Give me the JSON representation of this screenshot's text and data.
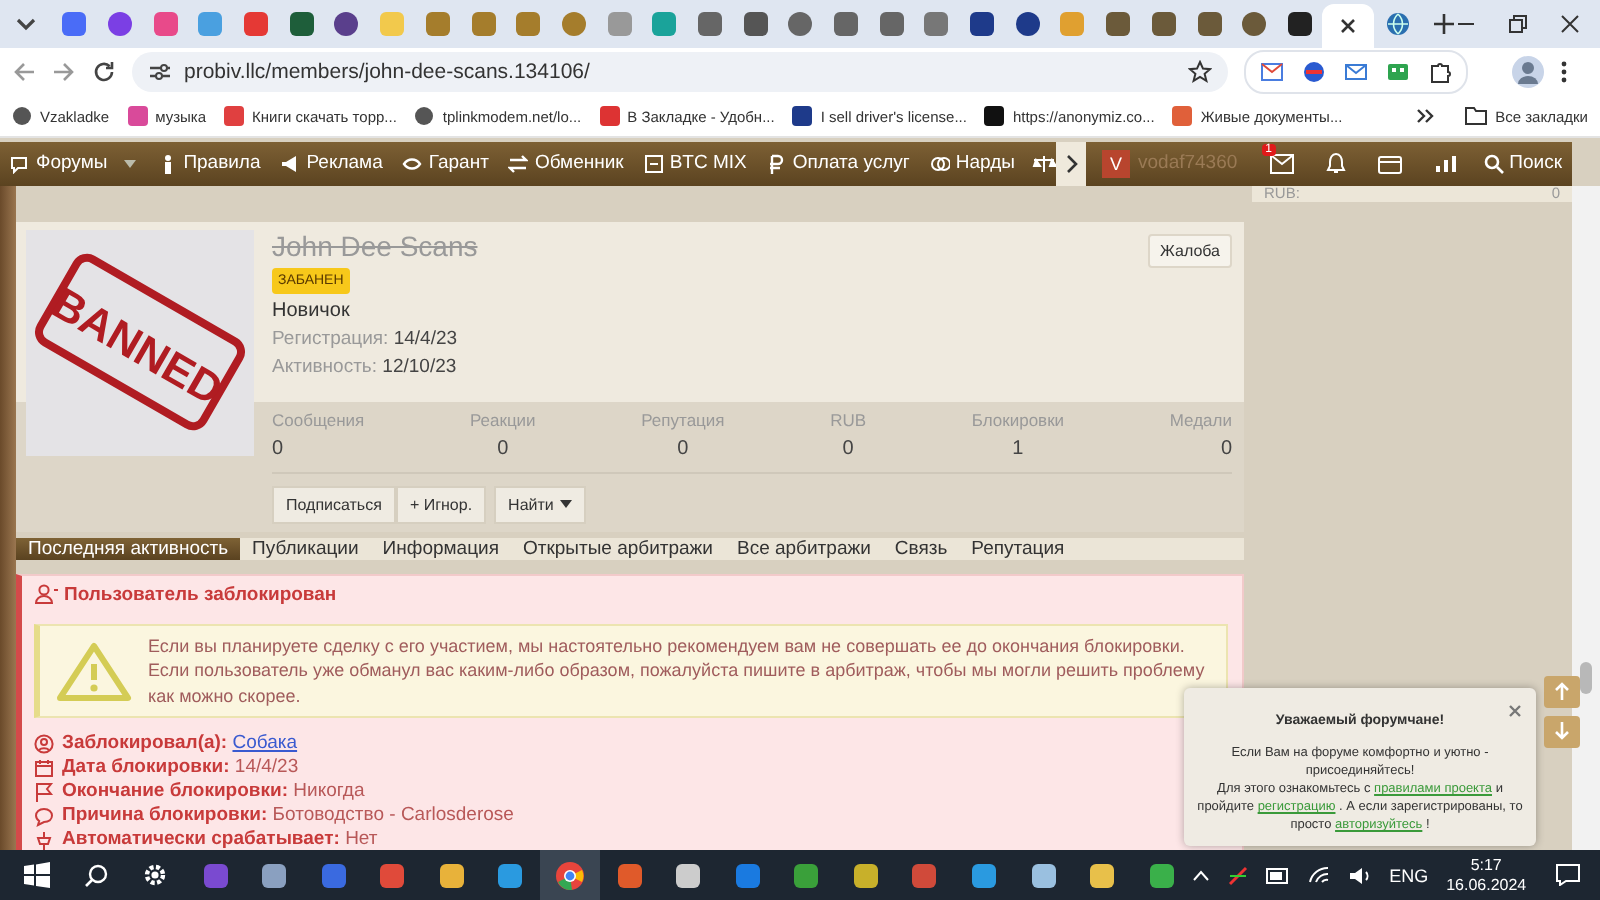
{
  "browser": {
    "url": "probiv.llc/members/john-dee-scans.134106/",
    "bookmarks": [
      "Vzakladke",
      "музыка",
      "Книги скачать торр...",
      "tplinkmodem.net/lo...",
      "В Закладке - Удобн...",
      "I sell driver's license...",
      "https://anonymiz.co...",
      "Живые документы..."
    ],
    "all_bookmarks": "Все закладки"
  },
  "nav": {
    "items": [
      "Форумы",
      "Правила",
      "Реклама",
      "Гарант",
      "Обменник",
      "BTC MIX",
      "Оплата услуг",
      "Нарды"
    ],
    "avatar_letter": "V",
    "user": "vodaf74360",
    "messages_badge": "1",
    "search": "Поиск"
  },
  "sidebar": {
    "label": "RUB:",
    "value": "0"
  },
  "profile": {
    "avatar_stamp": "BANNED",
    "name": "John Dee Scans",
    "badge": "ЗАБАНЕН",
    "title": "Новичок",
    "facts": [
      {
        "label": "Регистрация:",
        "value": "14/4/23"
      },
      {
        "label": "Активность:",
        "value": "12/10/23"
      }
    ],
    "report": "Жалоба",
    "stats": [
      {
        "label": "Сообщения",
        "value": "0"
      },
      {
        "label": "Реакции",
        "value": "0"
      },
      {
        "label": "Репутация",
        "value": "0"
      },
      {
        "label": "RUB",
        "value": "0"
      },
      {
        "label": "Блокировки",
        "value": "1"
      },
      {
        "label": "Медали",
        "value": "0"
      }
    ],
    "actions": [
      "Подписаться",
      "+ Игнор.",
      "Найти"
    ]
  },
  "tabs": [
    {
      "label": "Последняя активность",
      "selected": true
    },
    {
      "label": "Публикации",
      "selected": false
    },
    {
      "label": "Информация",
      "selected": false
    },
    {
      "label": "Открытые арбитражи",
      "selected": false
    },
    {
      "label": "Все арбитражи",
      "selected": false
    },
    {
      "label": "Связь",
      "selected": false
    },
    {
      "label": "Репутация",
      "selected": false
    }
  ],
  "ban": {
    "title": "Пользователь заблокирован",
    "warning": "Если вы планируете сделку с его участием, мы настоятельно рекомендуем вам не совершать ее до окончания блокировки. Если пользователь уже обманул вас каким-либо образом, пожалуйста пишите в арбитраж, чтобы мы могли решить проблему как можно скорее.",
    "details": [
      {
        "kind": "user",
        "label": "Заблокировал(а):",
        "value": "Собака"
      },
      {
        "kind": "date",
        "label": "Дата блокировки:",
        "value": "14/4/23"
      },
      {
        "kind": "end",
        "label": "Окончание блокировки:",
        "value": "Никогда"
      },
      {
        "kind": "reason",
        "label": "Причина блокировки:",
        "value": "Ботоводство - Carlosderose"
      },
      {
        "kind": "auto",
        "label": "Автоматически срабатывает:",
        "value": "Нет"
      }
    ]
  },
  "popup": {
    "title": "Уважаемый форумчане!",
    "intro": "Если Вам на форуме комфортно и уютно - присоединяйтесь!",
    "body": [
      {
        "kind": "text",
        "text": "Для этого ознакомьтесь с"
      },
      {
        "kind": "link",
        "text": "правилами проекта"
      },
      {
        "kind": "text",
        "text": "и пройдите"
      },
      {
        "kind": "link",
        "text": "регистрацию"
      },
      {
        "kind": "text",
        "text": ". А если зарегистрированы, то просто"
      },
      {
        "kind": "link",
        "text": "авторизуйтесь"
      },
      {
        "kind": "text",
        "text": "!"
      }
    ]
  },
  "taskbar": {
    "language": "ENG",
    "time": "5:17",
    "date": "16.06.2024"
  }
}
